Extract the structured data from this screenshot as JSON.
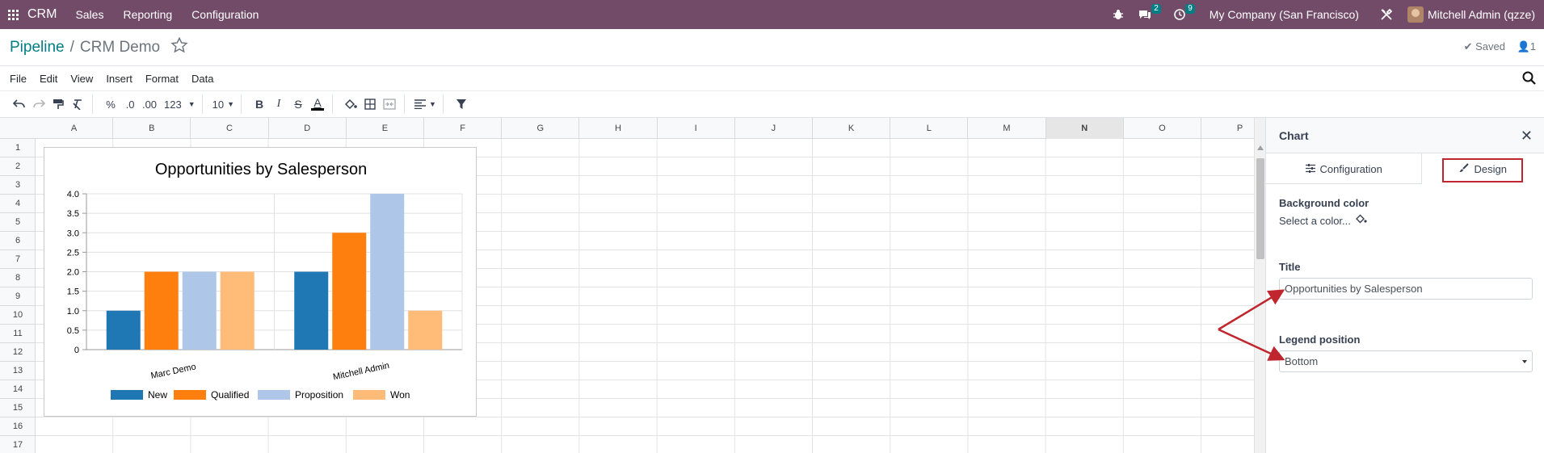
{
  "navbar": {
    "brand": "CRM",
    "menus": [
      "Sales",
      "Reporting",
      "Configuration"
    ],
    "chat_count": "2",
    "activity_count": "9",
    "company": "My Company (San Francisco)",
    "user": "Mitchell Admin (qzze)"
  },
  "breadcrumb": {
    "parent": "Pipeline",
    "separator": "/",
    "current": "CRM Demo"
  },
  "status": {
    "saved": "Saved",
    "users_count": "1"
  },
  "menubar": [
    "File",
    "Edit",
    "View",
    "Insert",
    "Format",
    "Data"
  ],
  "toolbar": {
    "percent": "%",
    "dec_less": ".0",
    "dec_more": ".00",
    "number_format": "123",
    "font_size": "10"
  },
  "columns": [
    "A",
    "B",
    "C",
    "D",
    "E",
    "F",
    "G",
    "H",
    "I",
    "J",
    "K",
    "L",
    "M",
    "N",
    "O",
    "P"
  ],
  "selected_column": "N",
  "rows": [
    "1",
    "2",
    "3",
    "4",
    "5",
    "6",
    "7",
    "8",
    "9",
    "10",
    "11",
    "12",
    "13",
    "14",
    "15",
    "16",
    "17"
  ],
  "chart_data": {
    "type": "bar",
    "title": "Opportunities by Salesperson",
    "categories": [
      "Marc Demo",
      "Mitchell Admin"
    ],
    "series": [
      {
        "name": "New",
        "values": [
          1,
          2
        ],
        "color": "#1f77b4"
      },
      {
        "name": "Qualified",
        "values": [
          2,
          3
        ],
        "color": "#ff7f0e"
      },
      {
        "name": "Proposition",
        "values": [
          2,
          4
        ],
        "color": "#aec7e8"
      },
      {
        "name": "Won",
        "values": [
          2,
          1
        ],
        "color": "#ffbb78"
      }
    ],
    "ylim": [
      0,
      4
    ],
    "yticks": [
      "0",
      "0.5",
      "1.0",
      "1.5",
      "2.0",
      "2.5",
      "3.0",
      "3.5",
      "4.0"
    ],
    "grid": true,
    "legend": "bottom"
  },
  "panel": {
    "title": "Chart",
    "tabs": [
      "Configuration",
      "Design"
    ],
    "active_tab": "Design",
    "bg_label": "Background color",
    "bg_placeholder": "Select a color...",
    "title_label": "Title",
    "title_value": "Opportunities by Salesperson",
    "legend_label": "Legend position",
    "legend_value": "Bottom"
  },
  "colors": {
    "navbar": "#714b67",
    "accent": "#017e84",
    "highlight": "#c0262d"
  }
}
